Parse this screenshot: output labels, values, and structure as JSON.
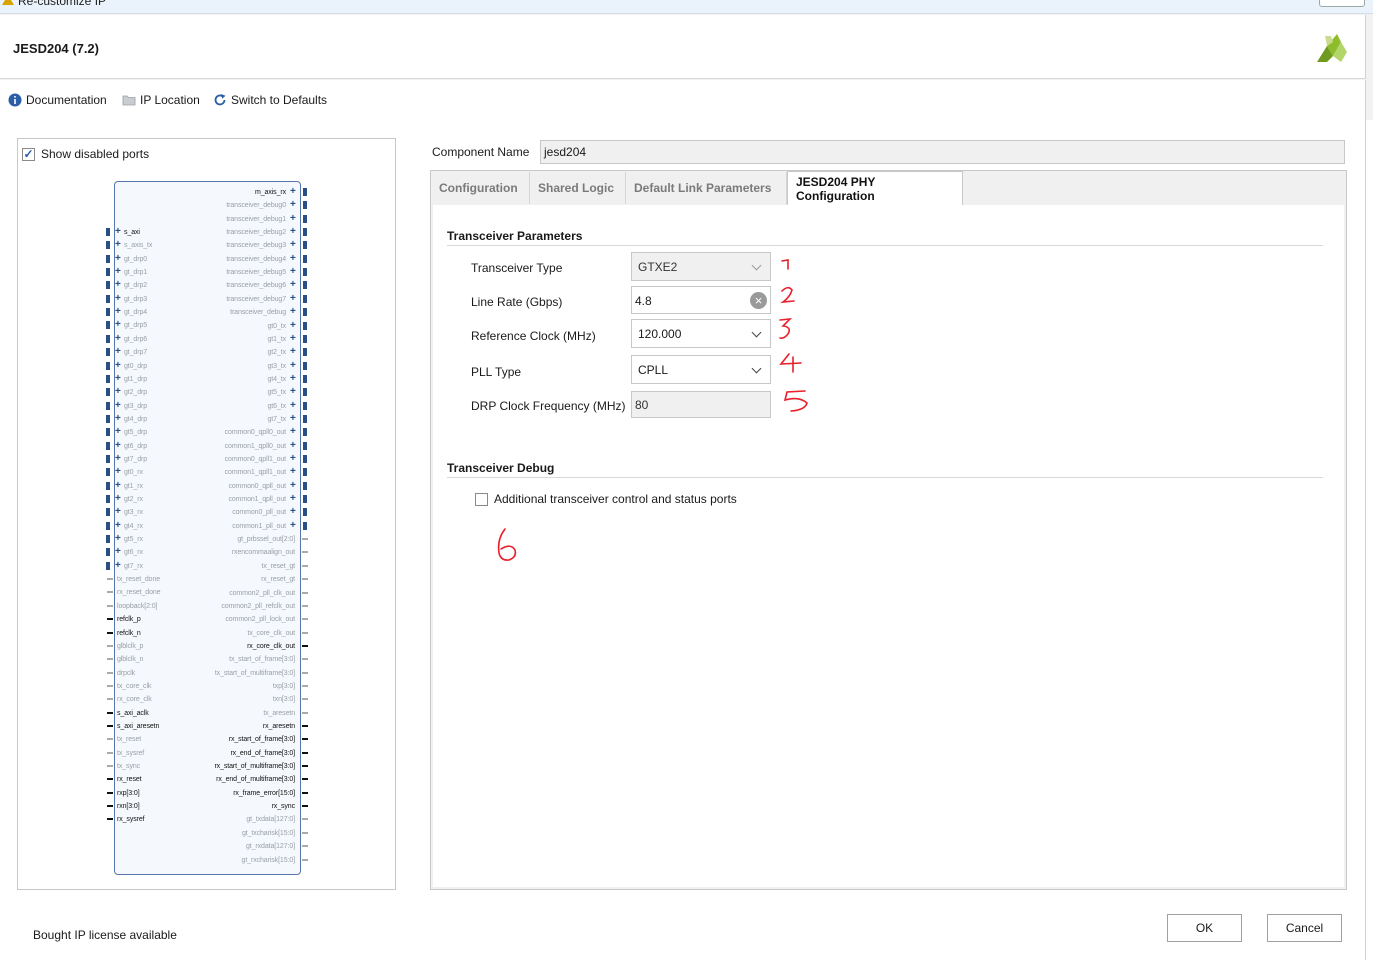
{
  "window": {
    "title": "Re-customize IP"
  },
  "header": {
    "ip_title": "JESD204 (7.2)"
  },
  "toolbar": {
    "documentation": "Documentation",
    "ip_location": "IP Location",
    "switch_defaults": "Switch to Defaults"
  },
  "symbol_panel": {
    "show_disabled_label": "Show disabled ports",
    "show_disabled_checked": true,
    "left_pins": [
      {
        "t": "s_axi",
        "a": true,
        "bus": true
      },
      {
        "t": "s_axis_tx",
        "a": false,
        "bus": true
      },
      {
        "t": "gt_drp0",
        "a": false,
        "bus": true
      },
      {
        "t": "gt_drp1",
        "a": false,
        "bus": true
      },
      {
        "t": "gt_drp2",
        "a": false,
        "bus": true
      },
      {
        "t": "gt_drp3",
        "a": false,
        "bus": true
      },
      {
        "t": "gt_drp4",
        "a": false,
        "bus": true
      },
      {
        "t": "gt_drp5",
        "a": false,
        "bus": true
      },
      {
        "t": "gt_drp6",
        "a": false,
        "bus": true
      },
      {
        "t": "gt_drp7",
        "a": false,
        "bus": true
      },
      {
        "t": "gt0_drp",
        "a": false,
        "bus": true
      },
      {
        "t": "gt1_drp",
        "a": false,
        "bus": true
      },
      {
        "t": "gt2_drp",
        "a": false,
        "bus": true
      },
      {
        "t": "gt3_drp",
        "a": false,
        "bus": true
      },
      {
        "t": "gt4_drp",
        "a": false,
        "bus": true
      },
      {
        "t": "gt5_drp",
        "a": false,
        "bus": true
      },
      {
        "t": "gt6_drp",
        "a": false,
        "bus": true
      },
      {
        "t": "gt7_drp",
        "a": false,
        "bus": true
      },
      {
        "t": "gt0_rx",
        "a": false,
        "bus": true
      },
      {
        "t": "gt1_rx",
        "a": false,
        "bus": true
      },
      {
        "t": "gt2_rx",
        "a": false,
        "bus": true
      },
      {
        "t": "gt3_rx",
        "a": false,
        "bus": true
      },
      {
        "t": "gt4_rx",
        "a": false,
        "bus": true
      },
      {
        "t": "gt5_rx",
        "a": false,
        "bus": true
      },
      {
        "t": "gt6_rx",
        "a": false,
        "bus": true
      },
      {
        "t": "gt7_rx",
        "a": false,
        "bus": true
      },
      {
        "t": "tx_reset_done",
        "a": false,
        "bus": false
      },
      {
        "t": "rx_reset_done",
        "a": false,
        "bus": false
      },
      {
        "t": "loopback[2:0]",
        "a": false,
        "bus": false
      },
      {
        "t": "refclk_p",
        "a": true,
        "bus": false
      },
      {
        "t": "refclk_n",
        "a": true,
        "bus": false
      },
      {
        "t": "glblclk_p",
        "a": false,
        "bus": false
      },
      {
        "t": "glblclk_n",
        "a": false,
        "bus": false
      },
      {
        "t": "drpclk",
        "a": false,
        "bus": false
      },
      {
        "t": "tx_core_clk",
        "a": false,
        "bus": false
      },
      {
        "t": "rx_core_clk",
        "a": false,
        "bus": false
      },
      {
        "t": "s_axi_aclk",
        "a": true,
        "bus": false
      },
      {
        "t": "s_axi_aresetn",
        "a": true,
        "bus": false
      },
      {
        "t": "tx_reset",
        "a": false,
        "bus": false
      },
      {
        "t": "tx_sysref",
        "a": false,
        "bus": false
      },
      {
        "t": "tx_sync",
        "a": false,
        "bus": false
      },
      {
        "t": "rx_reset",
        "a": true,
        "bus": false
      },
      {
        "t": "rxp[3:0]",
        "a": true,
        "bus": false
      },
      {
        "t": "rxn[3:0]",
        "a": true,
        "bus": false
      },
      {
        "t": "rx_sysref",
        "a": true,
        "bus": false
      }
    ],
    "right_pins": [
      {
        "t": "m_axis_rx",
        "a": true,
        "bus": true
      },
      {
        "t": "transceiver_debug0",
        "a": false,
        "bus": true
      },
      {
        "t": "transceiver_debug1",
        "a": false,
        "bus": true
      },
      {
        "t": "transceiver_debug2",
        "a": false,
        "bus": true
      },
      {
        "t": "transceiver_debug3",
        "a": false,
        "bus": true
      },
      {
        "t": "transceiver_debug4",
        "a": false,
        "bus": true
      },
      {
        "t": "transceiver_debug5",
        "a": false,
        "bus": true
      },
      {
        "t": "transceiver_debug6",
        "a": false,
        "bus": true
      },
      {
        "t": "transceiver_debug7",
        "a": false,
        "bus": true
      },
      {
        "t": "transceiver_debug",
        "a": false,
        "bus": true
      },
      {
        "t": "gt0_tx",
        "a": false,
        "bus": true
      },
      {
        "t": "gt1_tx",
        "a": false,
        "bus": true
      },
      {
        "t": "gt2_tx",
        "a": false,
        "bus": true
      },
      {
        "t": "gt3_tx",
        "a": false,
        "bus": true
      },
      {
        "t": "gt4_tx",
        "a": false,
        "bus": true
      },
      {
        "t": "gt5_tx",
        "a": false,
        "bus": true
      },
      {
        "t": "gt6_tx",
        "a": false,
        "bus": true
      },
      {
        "t": "gt7_tx",
        "a": false,
        "bus": true
      },
      {
        "t": "common0_qpll0_out",
        "a": false,
        "bus": true
      },
      {
        "t": "common1_qpll0_out",
        "a": false,
        "bus": true
      },
      {
        "t": "common0_qpll1_out",
        "a": false,
        "bus": true
      },
      {
        "t": "common1_qpll1_out",
        "a": false,
        "bus": true
      },
      {
        "t": "common0_qpll_out",
        "a": false,
        "bus": true
      },
      {
        "t": "common1_qpll_out",
        "a": false,
        "bus": true
      },
      {
        "t": "common0_pll_out",
        "a": false,
        "bus": true
      },
      {
        "t": "common1_pll_out",
        "a": false,
        "bus": true
      },
      {
        "t": "gt_prbssel_out[2:0]",
        "a": false,
        "bus": false
      },
      {
        "t": "rxencommaalign_out",
        "a": false,
        "bus": false
      },
      {
        "t": "tx_reset_gt",
        "a": false,
        "bus": false
      },
      {
        "t": "rx_reset_gt",
        "a": false,
        "bus": false
      },
      {
        "t": "common2_pll_clk_out",
        "a": false,
        "bus": false
      },
      {
        "t": "common2_pll_refclk_out",
        "a": false,
        "bus": false
      },
      {
        "t": "common2_pll_lock_out",
        "a": false,
        "bus": false
      },
      {
        "t": "tx_core_clk_out",
        "a": false,
        "bus": false
      },
      {
        "t": "rx_core_clk_out",
        "a": true,
        "bus": false
      },
      {
        "t": "tx_start_of_frame[3:0]",
        "a": false,
        "bus": false
      },
      {
        "t": "tx_start_of_multiframe[3:0]",
        "a": false,
        "bus": false
      },
      {
        "t": "txp[3:0]",
        "a": false,
        "bus": false
      },
      {
        "t": "txn[3:0]",
        "a": false,
        "bus": false
      },
      {
        "t": "tx_aresetn",
        "a": false,
        "bus": false
      },
      {
        "t": "rx_aresetn",
        "a": true,
        "bus": false
      },
      {
        "t": "rx_start_of_frame[3:0]",
        "a": true,
        "bus": false
      },
      {
        "t": "rx_end_of_frame[3:0]",
        "a": true,
        "bus": false
      },
      {
        "t": "rx_start_of_multiframe[3:0]",
        "a": true,
        "bus": false
      },
      {
        "t": "rx_end_of_multiframe[3:0]",
        "a": true,
        "bus": false
      },
      {
        "t": "rx_frame_error[15:0]",
        "a": true,
        "bus": false
      },
      {
        "t": "rx_sync",
        "a": true,
        "bus": false
      },
      {
        "t": "gt_txdata[127:0]",
        "a": false,
        "bus": false
      },
      {
        "t": "gt_txcharisk[15:0]",
        "a": false,
        "bus": false
      },
      {
        "t": "gt_rxdata[127:0]",
        "a": false,
        "bus": false
      },
      {
        "t": "gt_rxcharisk[15:0]",
        "a": false,
        "bus": false
      }
    ]
  },
  "component": {
    "label": "Component Name",
    "value": "jesd204"
  },
  "tabs": [
    {
      "label": "Configuration",
      "active": false
    },
    {
      "label": "Shared Logic",
      "active": false
    },
    {
      "label": "Default Link Parameters",
      "active": false
    },
    {
      "label": "JESD204 PHY Configuration",
      "active": true
    }
  ],
  "phy": {
    "section_params": "Transceiver Parameters",
    "transceiver_type": {
      "label": "Transceiver Type",
      "value": "GTXE2"
    },
    "line_rate": {
      "label": "Line Rate (Gbps)",
      "value": "4.8"
    },
    "ref_clock": {
      "label": "Reference Clock (MHz)",
      "value": "120.000"
    },
    "pll_type": {
      "label": "PLL Type",
      "value": "CPLL"
    },
    "drp_clock": {
      "label": "DRP Clock Frequency (MHz)",
      "value": "80"
    },
    "section_debug": "Transceiver Debug",
    "additional_ports": {
      "label": "Additional transceiver control and status ports",
      "checked": false
    }
  },
  "annotations": [
    "1",
    "2",
    "3",
    "4",
    "5",
    "6"
  ],
  "colors": {
    "annotation": "#e8202a",
    "brand": "#8dbd2b",
    "link_blue": "#2a4f86"
  },
  "footer": {
    "license": "Bought IP license available",
    "ok": "OK",
    "cancel": "Cancel"
  }
}
